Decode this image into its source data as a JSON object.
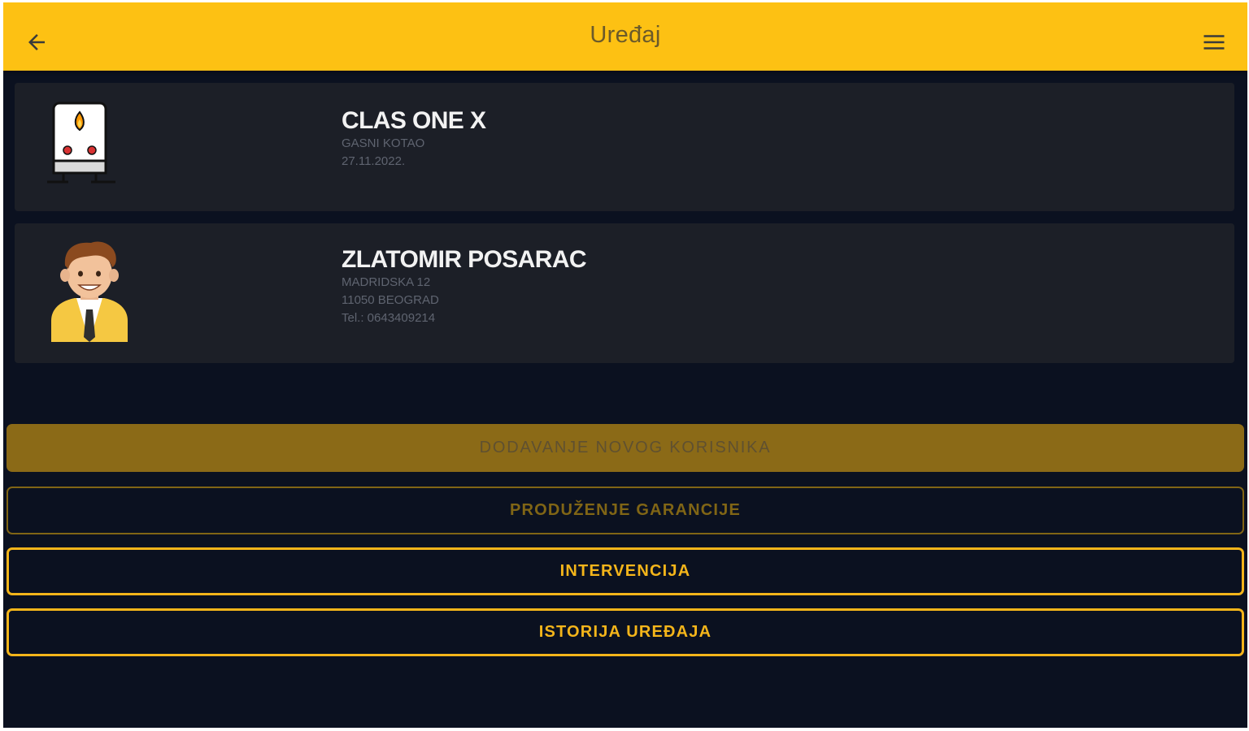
{
  "appbar": {
    "title": "Uređaj",
    "back_icon": "arrow-left-icon",
    "menu_icon": "hamburger-menu-icon"
  },
  "device": {
    "icon": "gas-boiler-icon",
    "name": "CLAS ONE X",
    "type": "GASNI KOTAO",
    "date": "27.11.2022."
  },
  "user": {
    "icon": "person-avatar-icon",
    "name": "ZLATOMIR POSARAC",
    "address": "MADRIDSKA 12",
    "city": "11050 BEOGRAD",
    "phone": "Tel.: 0643409214"
  },
  "actions": {
    "add_user": "DODAVANJE NOVOG KORISNIKA",
    "extend_warranty": "PRODUŽENJE GARANCIJE",
    "intervention": "INTERVENCIJA",
    "device_history": "ISTORIJA UREĐAJA"
  },
  "colors": {
    "appbar": "#fdc113",
    "background": "#0b1120",
    "card": "#1c1f27",
    "accent": "#f4b51a",
    "disabled_fill": "#8b6a17"
  }
}
